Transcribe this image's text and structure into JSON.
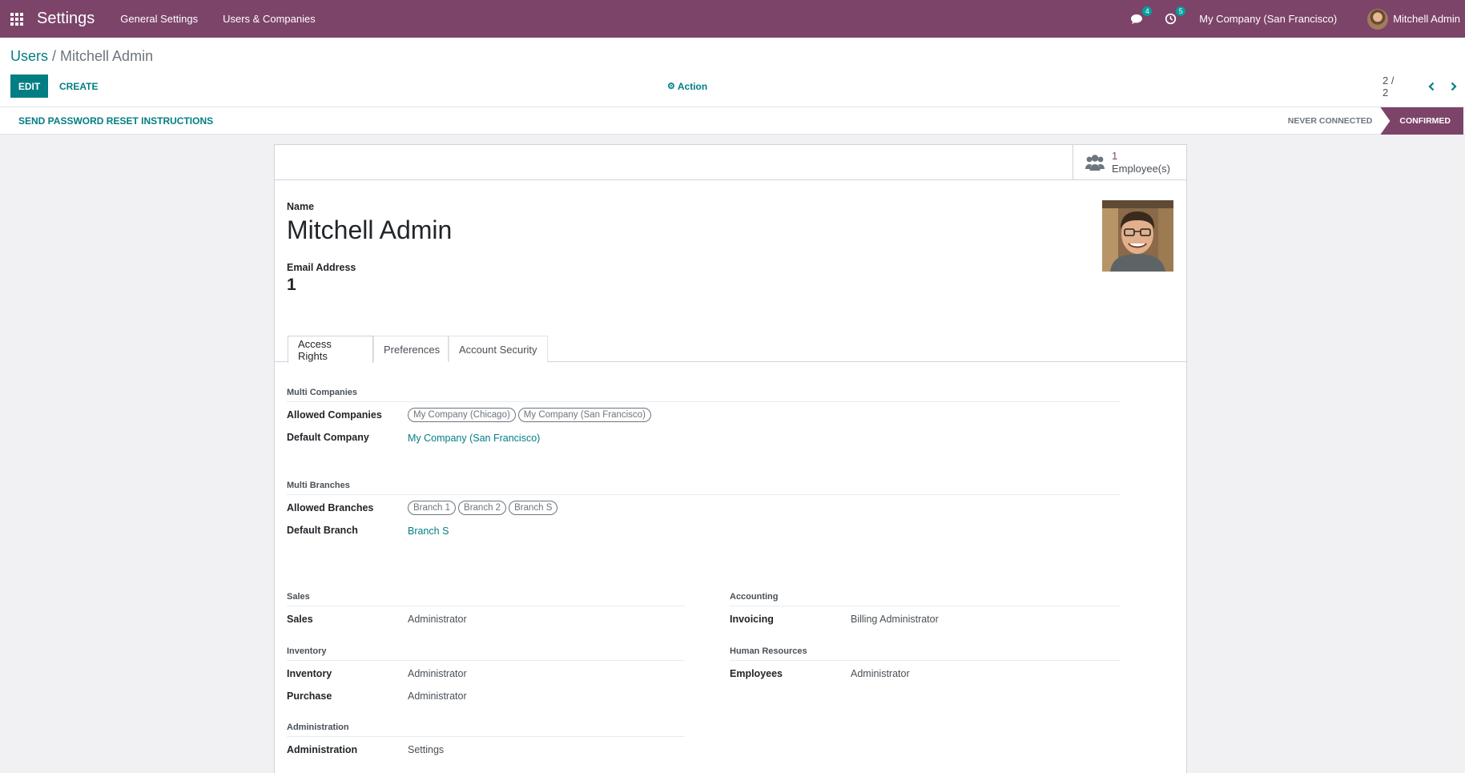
{
  "navbar": {
    "brand": "Settings",
    "menus": [
      "General Settings",
      "Users & Companies"
    ],
    "messages_count": "4",
    "activities_count": "5",
    "company": "My Company (San Francisco)",
    "user": "Mitchell Admin"
  },
  "breadcrumb": {
    "parent": "Users",
    "separator": " / ",
    "current": "Mitchell Admin"
  },
  "toolbar": {
    "edit_label": "EDIT",
    "create_label": "CREATE",
    "action_label": "Action"
  },
  "pager": {
    "value": "2 / 2"
  },
  "statusbar": {
    "reset_label": "SEND PASSWORD RESET INSTRUCTIONS",
    "states": [
      "NEVER CONNECTED",
      "CONFIRMED"
    ],
    "active_state": "CONFIRMED"
  },
  "stat_button": {
    "value": "1",
    "label": "Employee(s)"
  },
  "form": {
    "name_label": "Name",
    "name": "Mitchell Admin",
    "email_label": "Email Address",
    "email": "1"
  },
  "tabs": [
    "Access Rights",
    "Preferences",
    "Account Security"
  ],
  "active_tab": "Access Rights",
  "access": {
    "multi_companies": {
      "title": "Multi Companies",
      "allowed_label": "Allowed Companies",
      "allowed": [
        "My Company (Chicago)",
        "My Company (San Francisco)"
      ],
      "default_label": "Default Company",
      "default": "My Company (San Francisco)"
    },
    "multi_branches": {
      "title": "Multi Branches",
      "allowed_label": "Allowed Branches",
      "allowed": [
        "Branch 1",
        "Branch 2",
        "Branch S"
      ],
      "default_label": "Default Branch",
      "default": "Branch S"
    },
    "groups": {
      "sales": {
        "title": "Sales",
        "label": "Sales",
        "value": "Administrator"
      },
      "inventory": {
        "title": "Inventory",
        "inventory_label": "Inventory",
        "inventory_value": "Administrator",
        "purchase_label": "Purchase",
        "purchase_value": "Administrator"
      },
      "administration": {
        "title": "Administration",
        "label": "Administration",
        "value": "Settings"
      },
      "accounting": {
        "title": "Accounting",
        "label": "Invoicing",
        "value": "Billing Administrator"
      },
      "hr": {
        "title": "Human Resources",
        "label": "Employees",
        "value": "Administrator"
      }
    }
  }
}
